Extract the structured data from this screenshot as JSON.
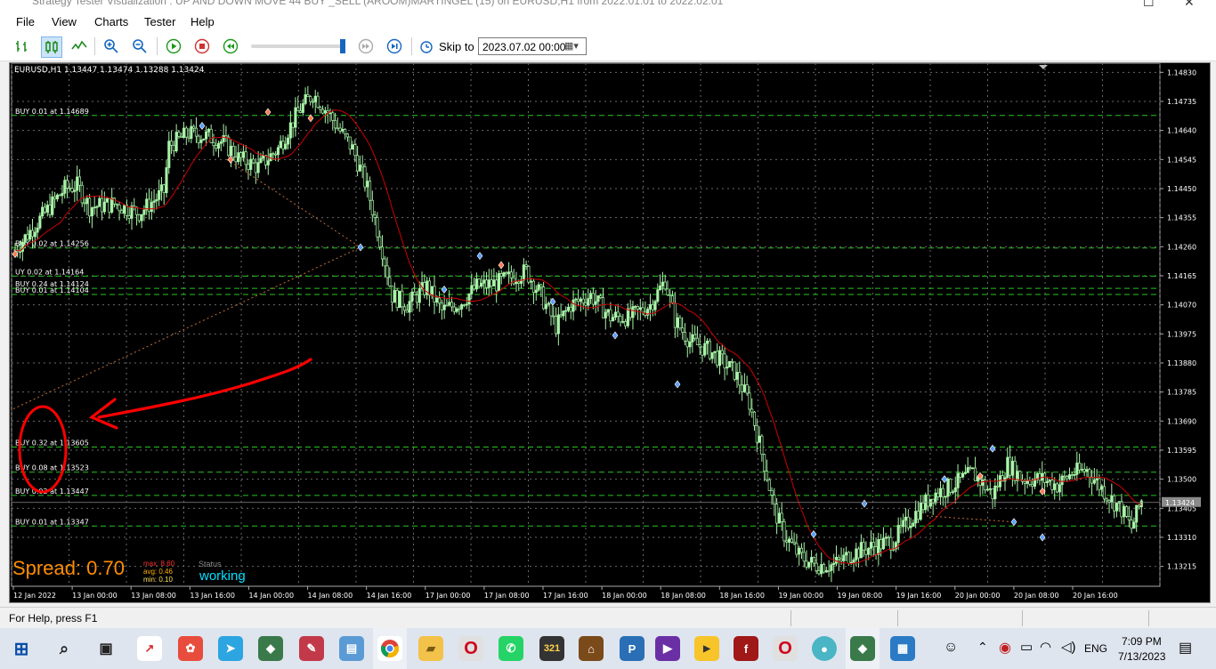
{
  "window": {
    "title": "Strategy Tester Visualization : UP AND DOWN MOVE 44 BUY _SELL (AROOM)MARTINGEL (15) on EURUSD,H1 from 2022.01.01 to 2022.02.01"
  },
  "menu": {
    "items": [
      "File",
      "View",
      "Charts",
      "Tester",
      "Help"
    ]
  },
  "toolbar": {
    "skip_label": "Skip to",
    "skip_date": "2023.07.02 00:00"
  },
  "chart": {
    "header": "EURUSD,H1  1.13447 1.13474 1.13288 1.13424",
    "current_price": "1.13424",
    "spread_text": "Spread: 0.70",
    "spread_stats": {
      "max": "max: 8.60",
      "avg": "avg: 0.46",
      "min": "min: 0.10"
    },
    "status_label": "Status",
    "status_value": "working",
    "colors": {
      "bull": "#a8f3a8",
      "ma": "#d00000",
      "grid": "#6a6a6a",
      "level": "#27c41f",
      "axis_text": "#ffffff",
      "annotation": "#ff0000",
      "spread": "#ff8c00",
      "status": "#00ffff"
    }
  },
  "chart_data": {
    "type": "candlestick",
    "symbol": "EURUSD,H1",
    "y_axis": [
      "1.14830",
      "1.14735",
      "1.14640",
      "1.14545",
      "1.14450",
      "1.14355",
      "1.14260",
      "1.14165",
      "1.14070",
      "1.13975",
      "1.13880",
      "1.13785",
      "1.13690",
      "1.13595",
      "1.13500",
      "1.13405",
      "1.13310",
      "1.13215"
    ],
    "ylim": [
      1.1315,
      1.1486
    ],
    "x_axis": [
      "12 Jan 2022",
      "13 Jan 00:00",
      "13 Jan 08:00",
      "13 Jan 16:00",
      "14 Jan 00:00",
      "14 Jan 08:00",
      "14 Jan 16:00",
      "17 Jan 00:00",
      "17 Jan 08:00",
      "17 Jan 16:00",
      "18 Jan 00:00",
      "18 Jan 08:00",
      "18 Jan 16:00",
      "19 Jan 00:00",
      "19 Jan 08:00",
      "19 Jan 16:00",
      "20 Jan 00:00",
      "20 Jan 08:00",
      "20 Jan 16:00"
    ],
    "levels": [
      {
        "label": "BUY 0.01 at 1.14689",
        "price": 1.14689
      },
      {
        "label": "BUY 0.02 at 1.14256",
        "price": 1.14256
      },
      {
        "label": "UY 0.02 at 1.14164",
        "price": 1.14164
      },
      {
        "label": "BUY 0.24 at 1.14124",
        "price": 1.14124
      },
      {
        "label": "BUY 0.01 at 1.14104",
        "price": 1.14104
      },
      {
        "label": "BUY 0.32 at 1.13605",
        "price": 1.13605
      },
      {
        "label": "BUY 0.08 at 1.13523",
        "price": 1.13523
      },
      {
        "label": "BUY 0.02 at 1.13447",
        "price": 1.13447
      },
      {
        "label": "BUY 0.01 at 1.13347",
        "price": 1.13347
      }
    ],
    "close_path": [
      [
        0,
        1.1425
      ],
      [
        10,
        1.1435
      ],
      [
        20,
        1.1445
      ],
      [
        25,
        1.1446
      ],
      [
        30,
        1.1439
      ],
      [
        40,
        1.144
      ],
      [
        50,
        1.1437
      ],
      [
        60,
        1.1444
      ],
      [
        62,
        1.1459
      ],
      [
        70,
        1.1463
      ],
      [
        78,
        1.1462
      ],
      [
        84,
        1.146
      ],
      [
        90,
        1.1455
      ],
      [
        98,
        1.1452
      ],
      [
        106,
        1.1458
      ],
      [
        114,
        1.147
      ],
      [
        120,
        1.1476
      ],
      [
        126,
        1.147
      ],
      [
        130,
        1.1465
      ],
      [
        136,
        1.1458
      ],
      [
        142,
        1.1445
      ],
      [
        148,
        1.1425
      ],
      [
        152,
        1.141
      ],
      [
        158,
        1.1407
      ],
      [
        166,
        1.1413
      ],
      [
        172,
        1.1405
      ],
      [
        180,
        1.1408
      ],
      [
        186,
        1.1413
      ],
      [
        194,
        1.1414
      ],
      [
        200,
        1.1416
      ],
      [
        206,
        1.1418
      ],
      [
        212,
        1.141
      ],
      [
        218,
        1.14
      ],
      [
        224,
        1.1407
      ],
      [
        232,
        1.141
      ],
      [
        240,
        1.1403
      ],
      [
        248,
        1.1403
      ],
      [
        256,
        1.1407
      ],
      [
        262,
        1.1415
      ],
      [
        266,
        1.1402
      ],
      [
        272,
        1.1395
      ],
      [
        280,
        1.1392
      ],
      [
        290,
        1.1385
      ],
      [
        296,
        1.1375
      ],
      [
        302,
        1.1355
      ],
      [
        306,
        1.134
      ],
      [
        310,
        1.1332
      ],
      [
        316,
        1.1325
      ],
      [
        322,
        1.1322
      ],
      [
        330,
        1.1322
      ],
      [
        338,
        1.1326
      ],
      [
        346,
        1.1328
      ],
      [
        354,
        1.133
      ],
      [
        362,
        1.1338
      ],
      [
        370,
        1.1345
      ],
      [
        378,
        1.1348
      ],
      [
        386,
        1.1352
      ],
      [
        394,
        1.1345
      ],
      [
        400,
        1.1355
      ],
      [
        406,
        1.135
      ],
      [
        414,
        1.135
      ],
      [
        420,
        1.1348
      ],
      [
        426,
        1.1352
      ],
      [
        432,
        1.1353
      ],
      [
        440,
        1.1345
      ],
      [
        446,
        1.134
      ],
      [
        450,
        1.1334
      ],
      [
        454,
        1.1343
      ]
    ],
    "ma_line": "red"
  },
  "statusbar": {
    "help": "For Help, press F1"
  },
  "taskbar": {
    "clock_time": "7:09 PM",
    "clock_date": "7/13/2023",
    "lang": "ENG"
  }
}
